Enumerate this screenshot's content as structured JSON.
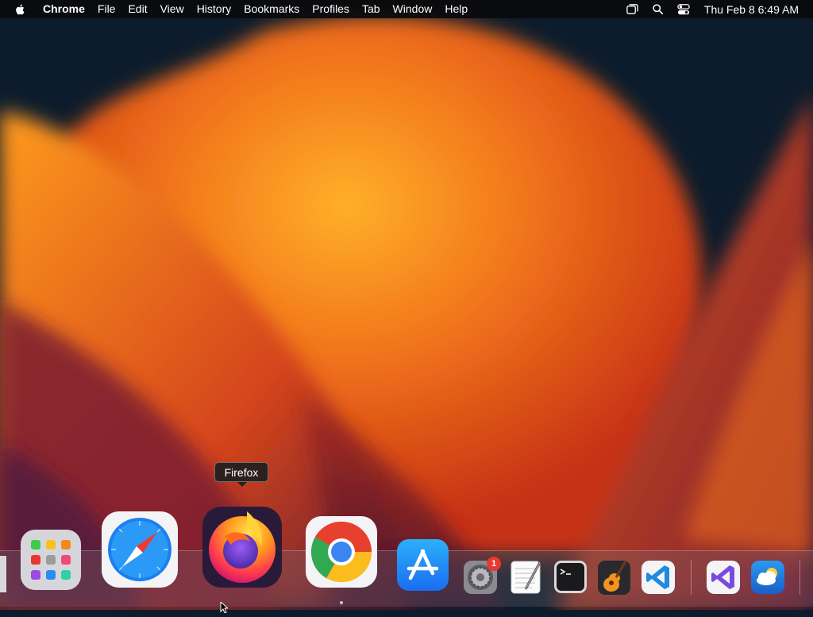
{
  "menubar": {
    "app_name": "Chrome",
    "items": [
      "File",
      "Edit",
      "View",
      "History",
      "Bookmarks",
      "Profiles",
      "Tab",
      "Window",
      "Help"
    ],
    "clock": "Thu Feb 8  6:49 AM",
    "status_icons": [
      "screen-mirroring-icon",
      "search-icon",
      "control-center-icon"
    ]
  },
  "tooltip": {
    "label": "Firefox"
  },
  "dock": {
    "apps": [
      "finder",
      "launchpad",
      "safari",
      "firefox",
      "chrome",
      "app-store",
      "system-settings",
      "textedit",
      "terminal",
      "garageband",
      "vscode",
      "visual-studio",
      "weather"
    ],
    "system_settings_badge": "1",
    "running_apps": [
      "chrome"
    ]
  },
  "colors": {
    "wallpaper_dark": "#0c1c2c",
    "wallpaper_orange": "#f07a10",
    "wallpaper_red": "#d8381a",
    "wallpaper_magenta": "#5a1a3a",
    "badge": "#e9382e"
  }
}
